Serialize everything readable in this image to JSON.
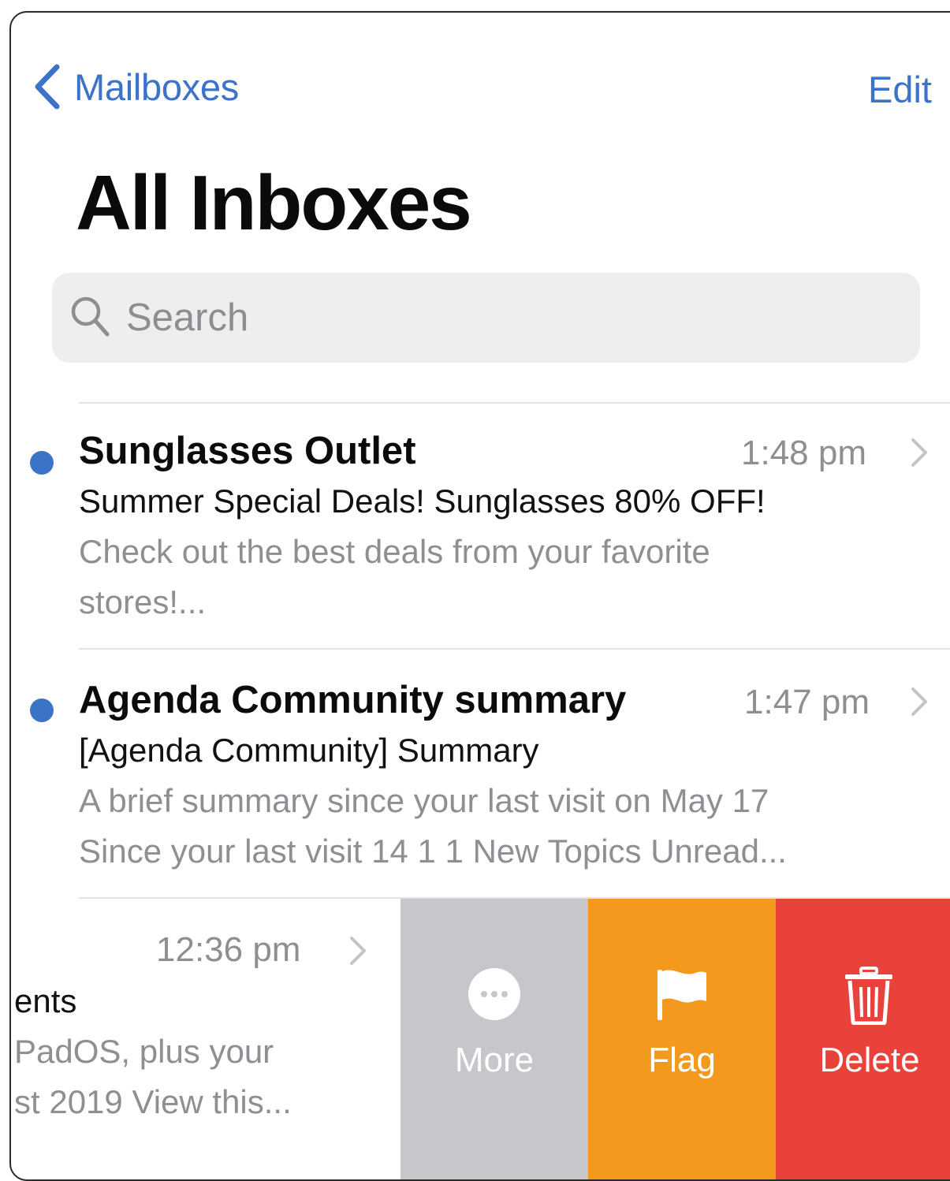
{
  "nav": {
    "back_label": "Mailboxes",
    "edit_label": "Edit"
  },
  "title": "All Inboxes",
  "search": {
    "placeholder": "Search"
  },
  "messages": [
    {
      "sender": "Sunglasses Outlet",
      "time": "1:48 pm",
      "subject": "Summer Special Deals! Sunglasses 80% OFF!",
      "preview_line1": "Check out the best deals from your favorite",
      "preview_line2": "stores!...",
      "unread": true
    },
    {
      "sender": "Agenda Community summary",
      "time": "1:47 pm",
      "subject": "[Agenda Community] Summary",
      "preview_line1": "A brief summary since your last visit on May 17",
      "preview_line2": "Since your last visit 14 1 1 New Topics Unread...",
      "unread": true
    },
    {
      "time": "12:36 pm",
      "subject_fragment": "ents",
      "preview_line1": "PadOS, plus your",
      "preview_line2": "st 2019 View this..."
    }
  ],
  "swipe_actions": {
    "more": {
      "label": "More",
      "color": "#c6c6cb",
      "icon": "ellipsis-circle-icon"
    },
    "flag": {
      "label": "Flag",
      "color": "#f39a1e",
      "icon": "flag-icon"
    },
    "delete": {
      "label": "Delete",
      "color": "#e8423a",
      "icon": "trash-icon"
    }
  },
  "colors": {
    "accent": "#3a73c9",
    "unread_dot": "#3b74c6"
  }
}
